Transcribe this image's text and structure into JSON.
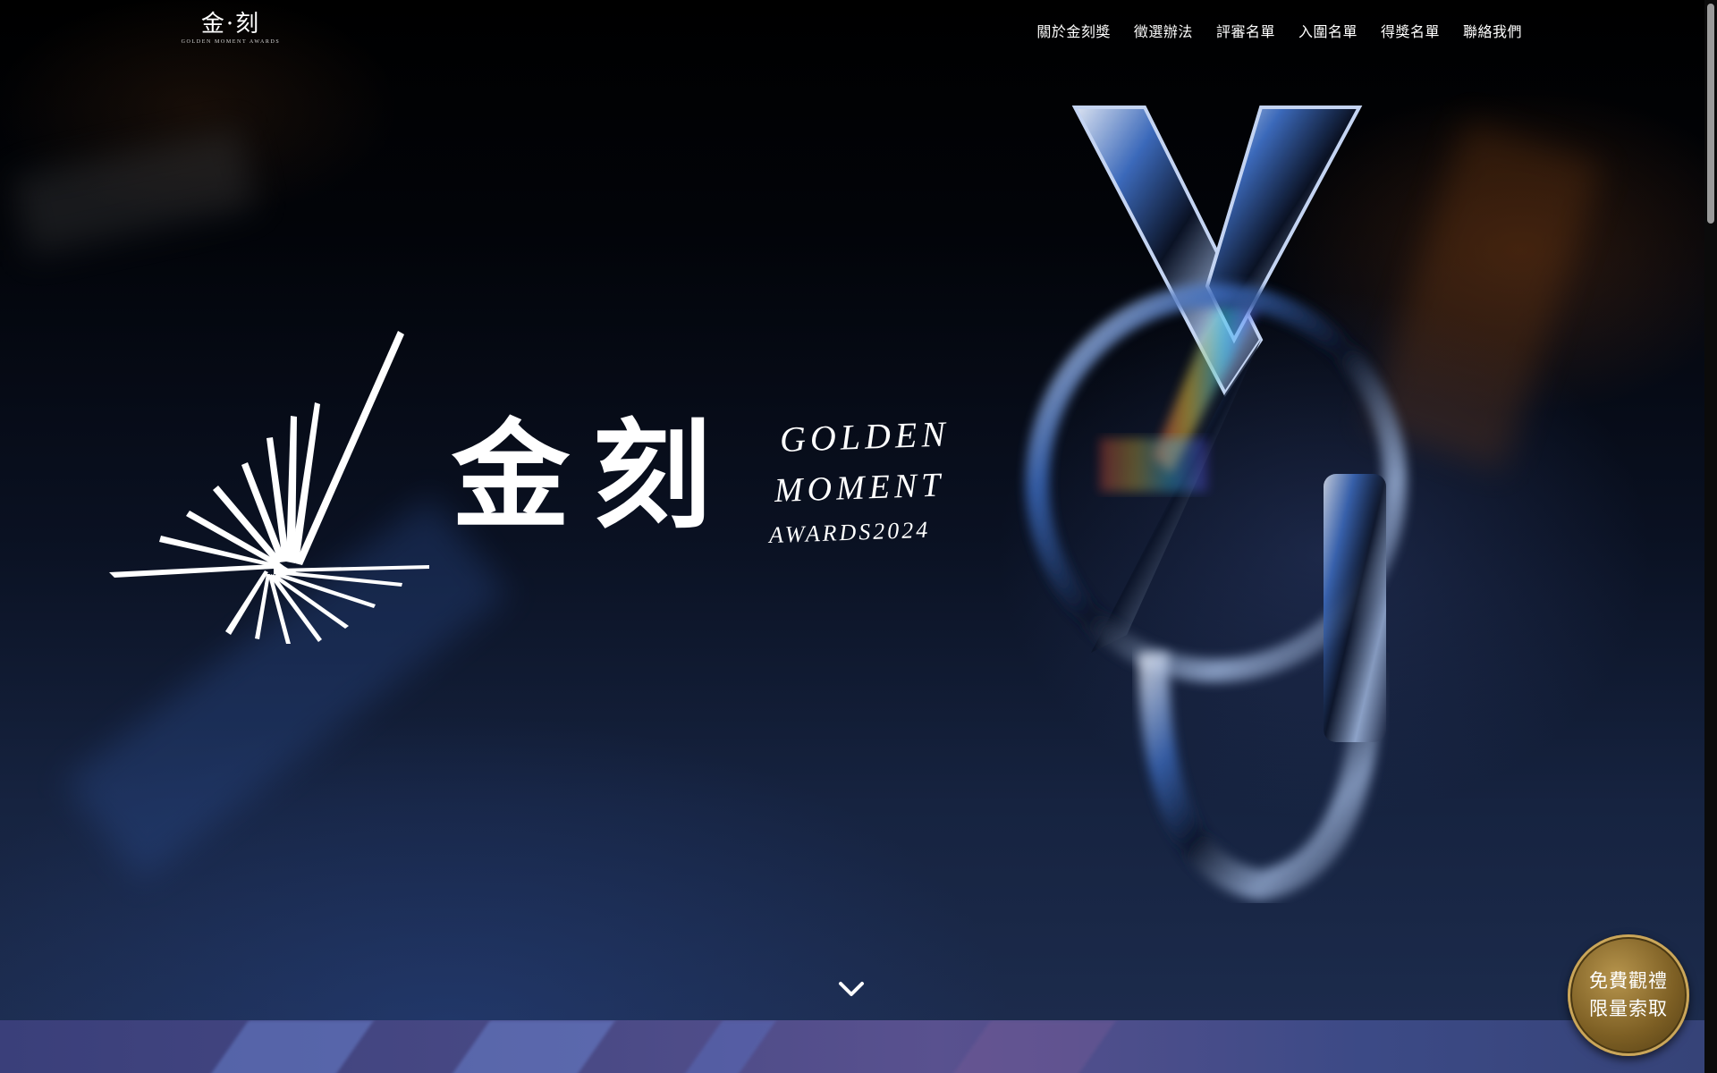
{
  "header": {
    "logo_cn": "金·刻",
    "logo_en": "GOLDEN MOMENT AWARDS"
  },
  "nav": {
    "items": [
      {
        "label": "關於金刻獎"
      },
      {
        "label": "徵選辦法"
      },
      {
        "label": "評審名單"
      },
      {
        "label": "入圍名單"
      },
      {
        "label": "得獎名單"
      },
      {
        "label": "聯絡我們"
      }
    ]
  },
  "hero": {
    "brand_cn": "金刻",
    "brand_en_line1": "GOLDEN",
    "brand_en_line2": "MOMENT",
    "brand_en_line3": "AWARDS2024"
  },
  "cta": {
    "line1": "免費觀禮",
    "line2": "限量索取"
  },
  "icons": {
    "scroll_down": "chevron-down-icon",
    "burst": "burst-logo-icon",
    "emblem": "emblem-artwork"
  },
  "colors": {
    "background_top": "#000000",
    "background_bottom": "#1c2b4c",
    "cta_gold": "#b7954d",
    "text": "#ffffff"
  }
}
